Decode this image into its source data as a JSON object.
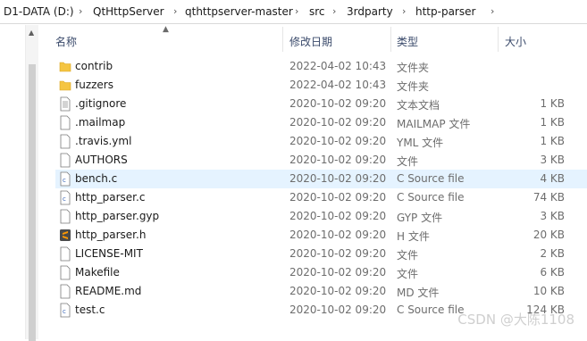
{
  "breadcrumb": {
    "items": [
      "D1-DATA (D:)",
      "QtHttpServer",
      "qthttpserver-master",
      "src",
      "3rdparty",
      "http-parser"
    ]
  },
  "columns": {
    "name": "名称",
    "date": "修改日期",
    "type": "类型",
    "size": "大小"
  },
  "files": [
    {
      "name": "contrib",
      "date": "2022-04-02 10:43",
      "type": "文件夹",
      "size": "",
      "icon": "folder-icon"
    },
    {
      "name": "fuzzers",
      "date": "2022-04-02 10:43",
      "type": "文件夹",
      "size": "",
      "icon": "folder-icon"
    },
    {
      "name": ".gitignore",
      "date": "2020-10-02 09:20",
      "type": "文本文档",
      "size": "1 KB",
      "icon": "text-file-icon"
    },
    {
      "name": ".mailmap",
      "date": "2020-10-02 09:20",
      "type": "MAILMAP 文件",
      "size": "1 KB",
      "icon": "file-icon"
    },
    {
      "name": ".travis.yml",
      "date": "2020-10-02 09:20",
      "type": "YML 文件",
      "size": "1 KB",
      "icon": "file-icon"
    },
    {
      "name": "AUTHORS",
      "date": "2020-10-02 09:20",
      "type": "文件",
      "size": "3 KB",
      "icon": "file-icon"
    },
    {
      "name": "bench.c",
      "date": "2020-10-02 09:20",
      "type": "C Source file",
      "size": "4 KB",
      "icon": "c-source-file-icon",
      "selected": true
    },
    {
      "name": "http_parser.c",
      "date": "2020-10-02 09:20",
      "type": "C Source file",
      "size": "74 KB",
      "icon": "c-source-file-icon"
    },
    {
      "name": "http_parser.gyp",
      "date": "2020-10-02 09:20",
      "type": "GYP 文件",
      "size": "3 KB",
      "icon": "file-icon"
    },
    {
      "name": "http_parser.h",
      "date": "2020-10-02 09:20",
      "type": "H 文件",
      "size": "20 KB",
      "icon": "sublime-header-file-icon"
    },
    {
      "name": "LICENSE-MIT",
      "date": "2020-10-02 09:20",
      "type": "文件",
      "size": "2 KB",
      "icon": "file-icon"
    },
    {
      "name": "Makefile",
      "date": "2020-10-02 09:20",
      "type": "文件",
      "size": "6 KB",
      "icon": "file-icon"
    },
    {
      "name": "README.md",
      "date": "2020-10-02 09:20",
      "type": "MD 文件",
      "size": "10 KB",
      "icon": "file-icon"
    },
    {
      "name": "test.c",
      "date": "2020-10-02 09:20",
      "type": "C Source file",
      "size": "124 KB",
      "icon": "c-source-file-icon"
    }
  ],
  "watermark": "CSDN @大陈1108",
  "colors": {
    "selection": "#e5f3ff",
    "folder": "#f5c542",
    "sublime": "#ff9800"
  }
}
